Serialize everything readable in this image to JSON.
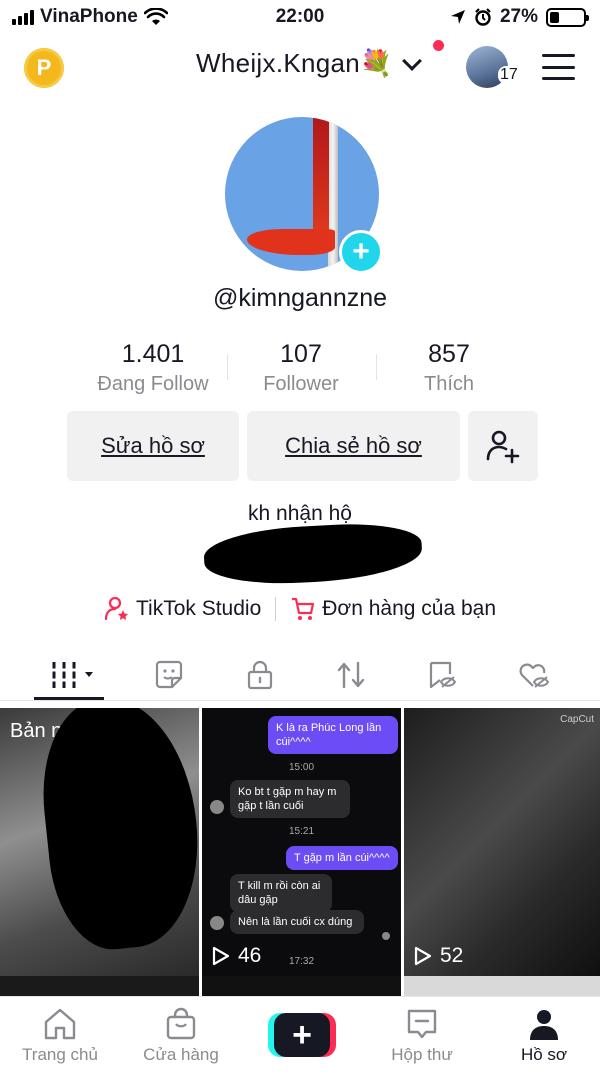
{
  "status_bar": {
    "carrier": "VinaPhone",
    "time": "22:00",
    "battery": "27%",
    "battery_level": 0.27
  },
  "header": {
    "coin_label": "P",
    "username": "Wheijx.Kngan💐",
    "notification_count": "17"
  },
  "profile": {
    "handle": "@kimngannzne",
    "bio": "kh nhận hộ"
  },
  "stats": [
    {
      "value": "1.401",
      "label": "Đang Follow"
    },
    {
      "value": "107",
      "label": "Follower"
    },
    {
      "value": "857",
      "label": "Thích"
    }
  ],
  "buttons": {
    "edit": "Sửa hồ sơ",
    "share": "Chia sẻ hồ sơ"
  },
  "links": {
    "studio": "TikTok Studio",
    "orders": "Đơn hàng của bạn"
  },
  "grid": {
    "draft_label": "Bản nháp",
    "video2": {
      "views": "46",
      "messages": [
        {
          "text": "K là ra Phúc Long lần cúi^^^^"
        },
        {
          "text": "15:00"
        },
        {
          "text": "Ko bt t gặp m hay m gặp t lần cuối"
        },
        {
          "text": "15:21"
        },
        {
          "text": "T gặp m lần cúi^^^^"
        },
        {
          "text": "T kill m rồi còn ai dâu gặp"
        },
        {
          "text": "Nên là lần cuối cx dúng"
        },
        {
          "text": "17:32"
        }
      ]
    },
    "video3": {
      "views": "52"
    },
    "watermark": "CapCut"
  },
  "nav": {
    "home": "Trang chủ",
    "shop": "Cửa hàng",
    "inbox": "Hộp thư",
    "profile": "Hồ sơ"
  }
}
